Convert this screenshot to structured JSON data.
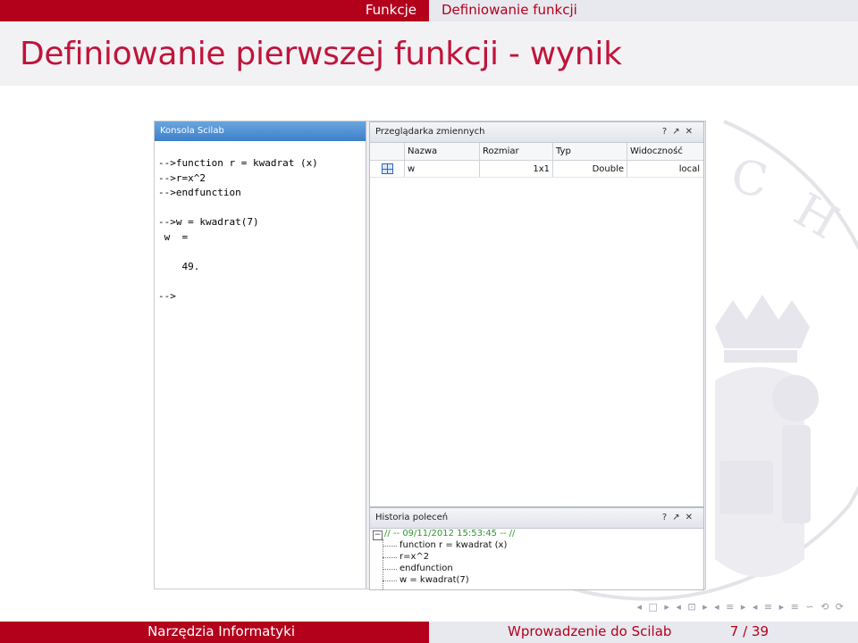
{
  "header": {
    "section": "Funkcje",
    "subsection": "Definiowanie funkcji",
    "frame_title": "Definiowanie pierwszej funkcji - wynik"
  },
  "console": {
    "title": "Konsola Scilab",
    "lines": [
      "-->function r = kwadrat (x)",
      "-->r=x^2",
      "-->endfunction",
      "",
      "-->w = kwadrat(7)",
      " w  =",
      "",
      "    49.",
      "",
      "-->"
    ]
  },
  "variable_browser": {
    "title": "Przeglądarka zmiennych",
    "columns": [
      "Nazwa",
      "Rozmiar",
      "Typ",
      "Widoczność"
    ],
    "rows": [
      {
        "name": "w",
        "size": "1x1",
        "type": "Double",
        "visibility": "local"
      }
    ],
    "buttons": [
      "?",
      "↗",
      "✕"
    ]
  },
  "history": {
    "title": "Historia poleceń",
    "session": "// -- 09/11/2012 15:53:45 -- //",
    "entries": [
      "function r = kwadrat (x)",
      "r=x^2",
      "endfunction",
      "w = kwadrat(7)"
    ],
    "buttons": [
      "?",
      "↗",
      "✕"
    ]
  },
  "footer": {
    "left": "Narzędzia Informatyki",
    "center": "Wprowadzenie do Scilab",
    "page": "7 / 39"
  },
  "nav_symbols": "◂ □ ▸ ◂ ⊡ ▸ ◂ ≡ ▸ ◂ ≡ ▸ ≡ ∽ ⟲ ⟳",
  "colors": {
    "accent": "#b3001b",
    "title": "#c0143a"
  }
}
